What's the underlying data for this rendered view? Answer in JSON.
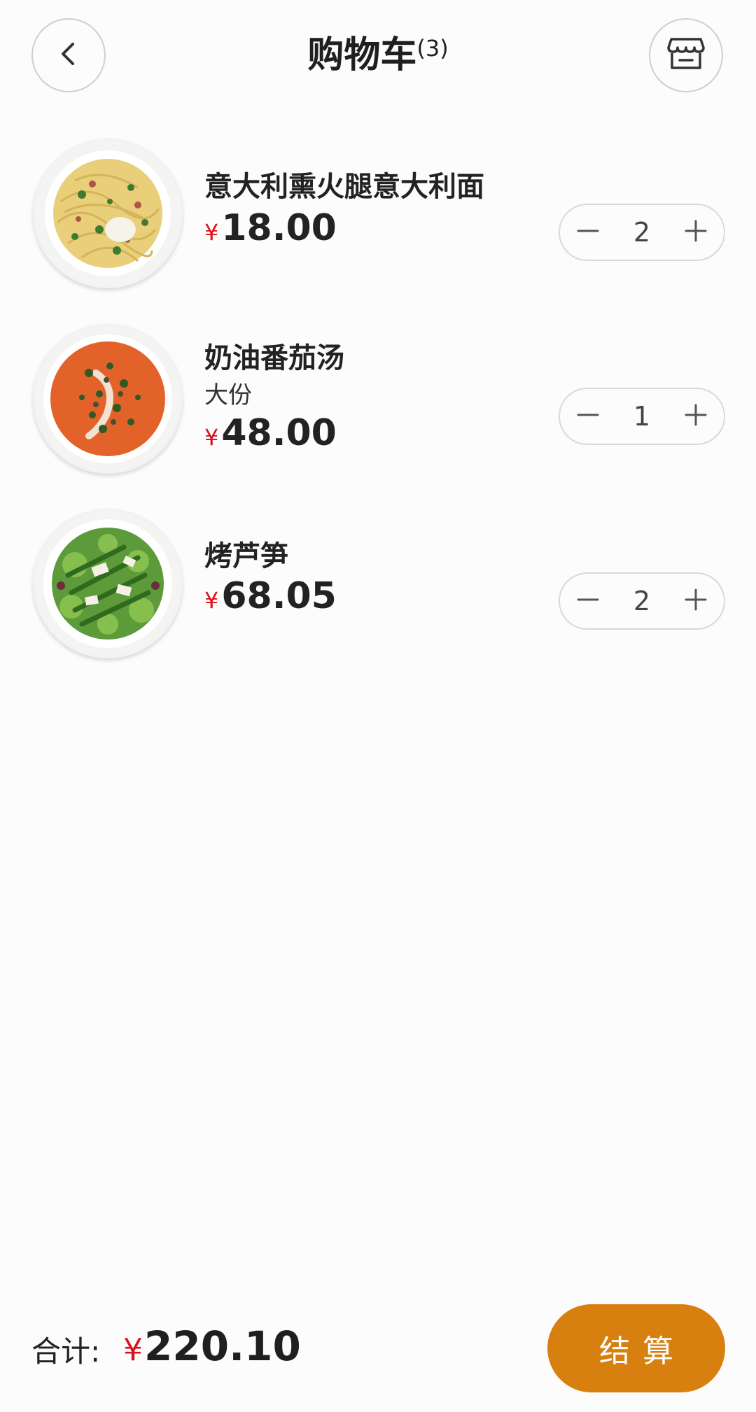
{
  "header": {
    "title": "购物车",
    "count": "(3)",
    "back_icon": "chevron-left-icon",
    "shop_icon": "store-icon"
  },
  "currency": "¥",
  "items": [
    {
      "name": "意大利熏火腿意大利面",
      "variant": "",
      "price": "18.00",
      "quantity": "2",
      "image": "spaghetti-plate"
    },
    {
      "name": "奶油番茄汤",
      "variant": "大份",
      "price": "48.00",
      "quantity": "1",
      "image": "tomato-soup-bowl"
    },
    {
      "name": "烤芦笋",
      "variant": "",
      "price": "68.05",
      "quantity": "2",
      "image": "asparagus-salad-plate"
    }
  ],
  "footer": {
    "total_label": "合计:",
    "total": "220.10",
    "checkout_label": "结算"
  },
  "colors": {
    "accent": "#d8800f",
    "price_symbol": "#d8121d",
    "background": "#fcfcfd"
  }
}
